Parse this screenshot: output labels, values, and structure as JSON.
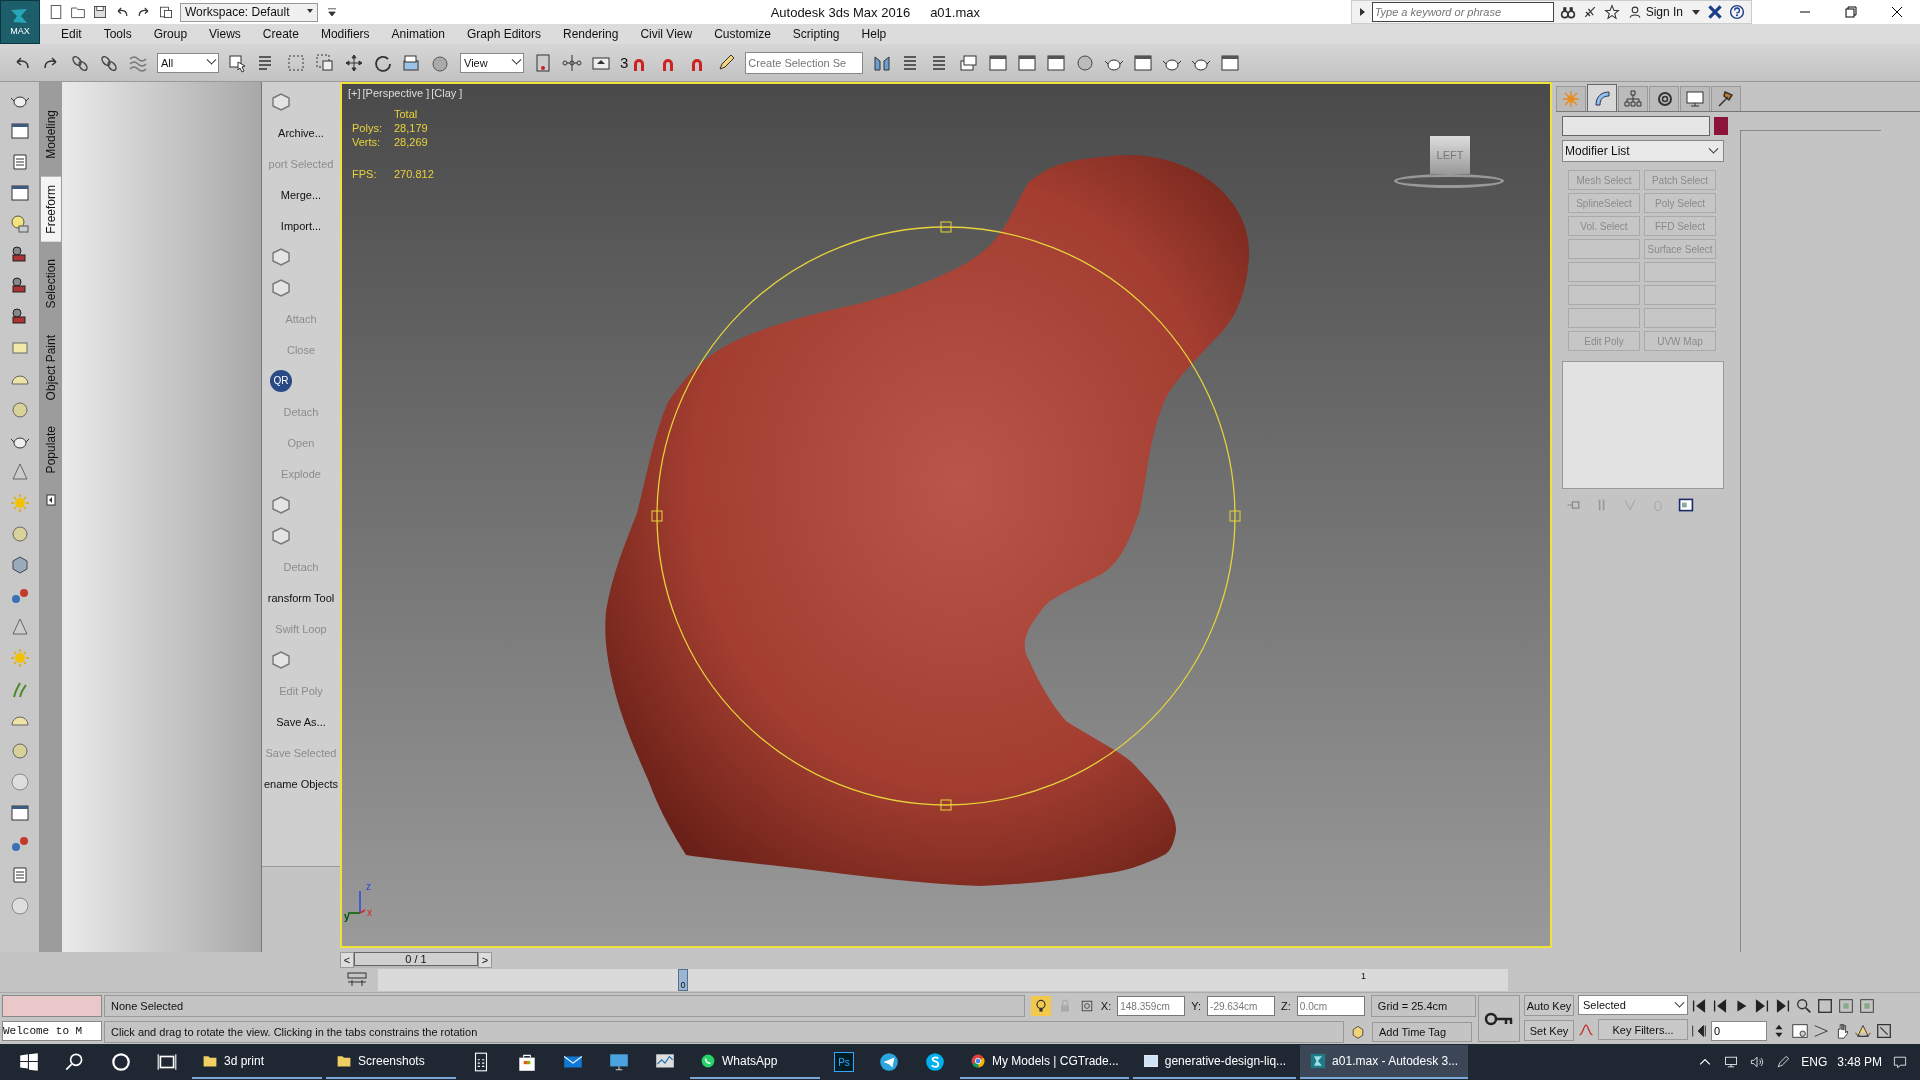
{
  "title_bar": {
    "app_button": "MAX",
    "workspace": "Workspace: Default",
    "title": "Autodesk 3ds Max 2016",
    "file": "a01.max",
    "search": {
      "placeholder": "Type a keyword or phrase"
    },
    "sign_in": "Sign In"
  },
  "menu": [
    "Edit",
    "Tools",
    "Group",
    "Views",
    "Create",
    "Modifiers",
    "Animation",
    "Graph Editors",
    "Rendering",
    "Civil View",
    "Customize",
    "Scripting",
    "Help"
  ],
  "toolbar": {
    "selection_filter": "All",
    "reference_coord": "View",
    "snap_label": "3",
    "named_selection": {
      "placeholder": "Create Selection Se"
    }
  },
  "ribbon_tabs": [
    {
      "label": "Modeling",
      "selected": false
    },
    {
      "label": "Freeform",
      "selected": true
    },
    {
      "label": "Selection",
      "selected": false
    },
    {
      "label": "Object Paint",
      "selected": false
    },
    {
      "label": "Populate",
      "selected": false
    }
  ],
  "tools": [
    {
      "kind": "icon"
    },
    {
      "kind": "button",
      "label": "Archive...",
      "disabled": false
    },
    {
      "kind": "button",
      "label": "port Selected",
      "disabled": true
    },
    {
      "kind": "button",
      "label": "Merge...",
      "disabled": false
    },
    {
      "kind": "button",
      "label": "Import...",
      "disabled": false
    },
    {
      "kind": "icon"
    },
    {
      "kind": "icon"
    },
    {
      "kind": "button",
      "label": "Attach",
      "disabled": true
    },
    {
      "kind": "button",
      "label": "Close",
      "disabled": true
    },
    {
      "kind": "badge",
      "label": "QR"
    },
    {
      "kind": "button",
      "label": "Detach",
      "disabled": true
    },
    {
      "kind": "button",
      "label": "Open",
      "disabled": true
    },
    {
      "kind": "button",
      "label": "Explode",
      "disabled": true
    },
    {
      "kind": "icon"
    },
    {
      "kind": "icon"
    },
    {
      "kind": "button",
      "label": "Detach",
      "disabled": true
    },
    {
      "kind": "button",
      "label": "ransform Tool",
      "disabled": false
    },
    {
      "kind": "button",
      "label": "Swift Loop",
      "disabled": true
    },
    {
      "kind": "icon"
    },
    {
      "kind": "button",
      "label": "Edit Poly",
      "disabled": true
    },
    {
      "kind": "button",
      "label": "Save As...",
      "disabled": false
    },
    {
      "kind": "button",
      "label": "Save Selected",
      "disabled": true
    },
    {
      "kind": "button",
      "label": "ename Objects",
      "disabled": false
    }
  ],
  "viewport": {
    "labels": [
      "[+]",
      "[Perspective ]",
      "[Clay ]"
    ],
    "stats": {
      "header": "Total",
      "rows": [
        {
          "label": "Polys:",
          "value": "28,179"
        },
        {
          "label": "Verts:",
          "value": "28,269"
        }
      ],
      "fps_label": "FPS:",
      "fps": "270.812"
    },
    "viewcube": "LEFT",
    "axes": {
      "z": "z",
      "y": "y",
      "x": "x"
    }
  },
  "time_slider": {
    "prev": "<",
    "frame": "0 / 1",
    "level": 1,
    "next": ">",
    "thumb": "0",
    "tick": "1"
  },
  "command_panel": {
    "tabs": [
      {
        "selected": false
      },
      {
        "selected": true
      },
      {
        "selected": false
      },
      {
        "selected": false
      },
      {
        "selected": false
      },
      {
        "selected": false
      }
    ],
    "color": "#8a1538",
    "modifier_list": "Modifier List",
    "buttons": [
      {
        "kind": "label",
        "label": "Mesh Select",
        "disabled": true
      },
      {
        "kind": "label",
        "label": "Patch Select",
        "disabled": true
      },
      {
        "kind": "label",
        "label": "SplineSelect",
        "disabled": true
      },
      {
        "kind": "label",
        "label": "Poly Select",
        "disabled": true
      },
      {
        "kind": "label",
        "label": "Vol. Select",
        "disabled": true
      },
      {
        "kind": "label",
        "label": "FFD Select",
        "disabled": true
      },
      {
        "kind": "blank"
      },
      {
        "kind": "label",
        "label": "Surface Select",
        "disabled": true
      },
      {
        "kind": "blank"
      },
      {
        "kind": "blank"
      },
      {
        "kind": "blank"
      },
      {
        "kind": "blank"
      },
      {
        "kind": "blank"
      },
      {
        "kind": "blank"
      },
      {
        "kind": "label",
        "label": "Edit Poly",
        "disabled": true
      },
      {
        "kind": "label",
        "label": "UVW Map",
        "disabled": true
      }
    ]
  },
  "status": {
    "mini_listener": "Welcome to M",
    "selection": "None Selected",
    "prompt": "Click and drag to rotate the view.  Clicking in the tabs constrains the rotation",
    "isolate_on": true,
    "coords": [
      {
        "label": "X:",
        "value": "148.359cm"
      },
      {
        "label": "Y:",
        "value": "-29.634cm"
      },
      {
        "label": "Z:",
        "value": "0.0cm"
      }
    ],
    "grid": "Grid = 25.4cm",
    "add_time_tag": "Add Time Tag",
    "auto_key": "Auto Key",
    "set_key": "Set Key",
    "key_mode": "Selected",
    "key_filters": "Key Filters...",
    "frame": "0"
  },
  "taskbar": {
    "apps": [
      {
        "kind": "folder",
        "label": "3d print",
        "active": false
      },
      {
        "kind": "folder",
        "label": "Screenshots",
        "active": false
      },
      {
        "kind": "calculator"
      },
      {
        "kind": "store"
      },
      {
        "kind": "mail"
      },
      {
        "kind": "computer"
      },
      {
        "kind": "monitor"
      },
      {
        "kind": "chat",
        "label": "WhatsApp",
        "active": false
      },
      {
        "kind": "ps"
      },
      {
        "kind": "telegram"
      },
      {
        "kind": "skype"
      },
      {
        "kind": "browser",
        "label": "My Models | CGTrade...",
        "active": false
      },
      {
        "kind": "window",
        "label": "generative-design-liq...",
        "active": false
      },
      {
        "kind": "max",
        "label": "a01.max - Autodesk 3...",
        "active": true
      }
    ],
    "ps_label": "Ps",
    "language": "ENG",
    "time": "3:48 PM"
  }
}
